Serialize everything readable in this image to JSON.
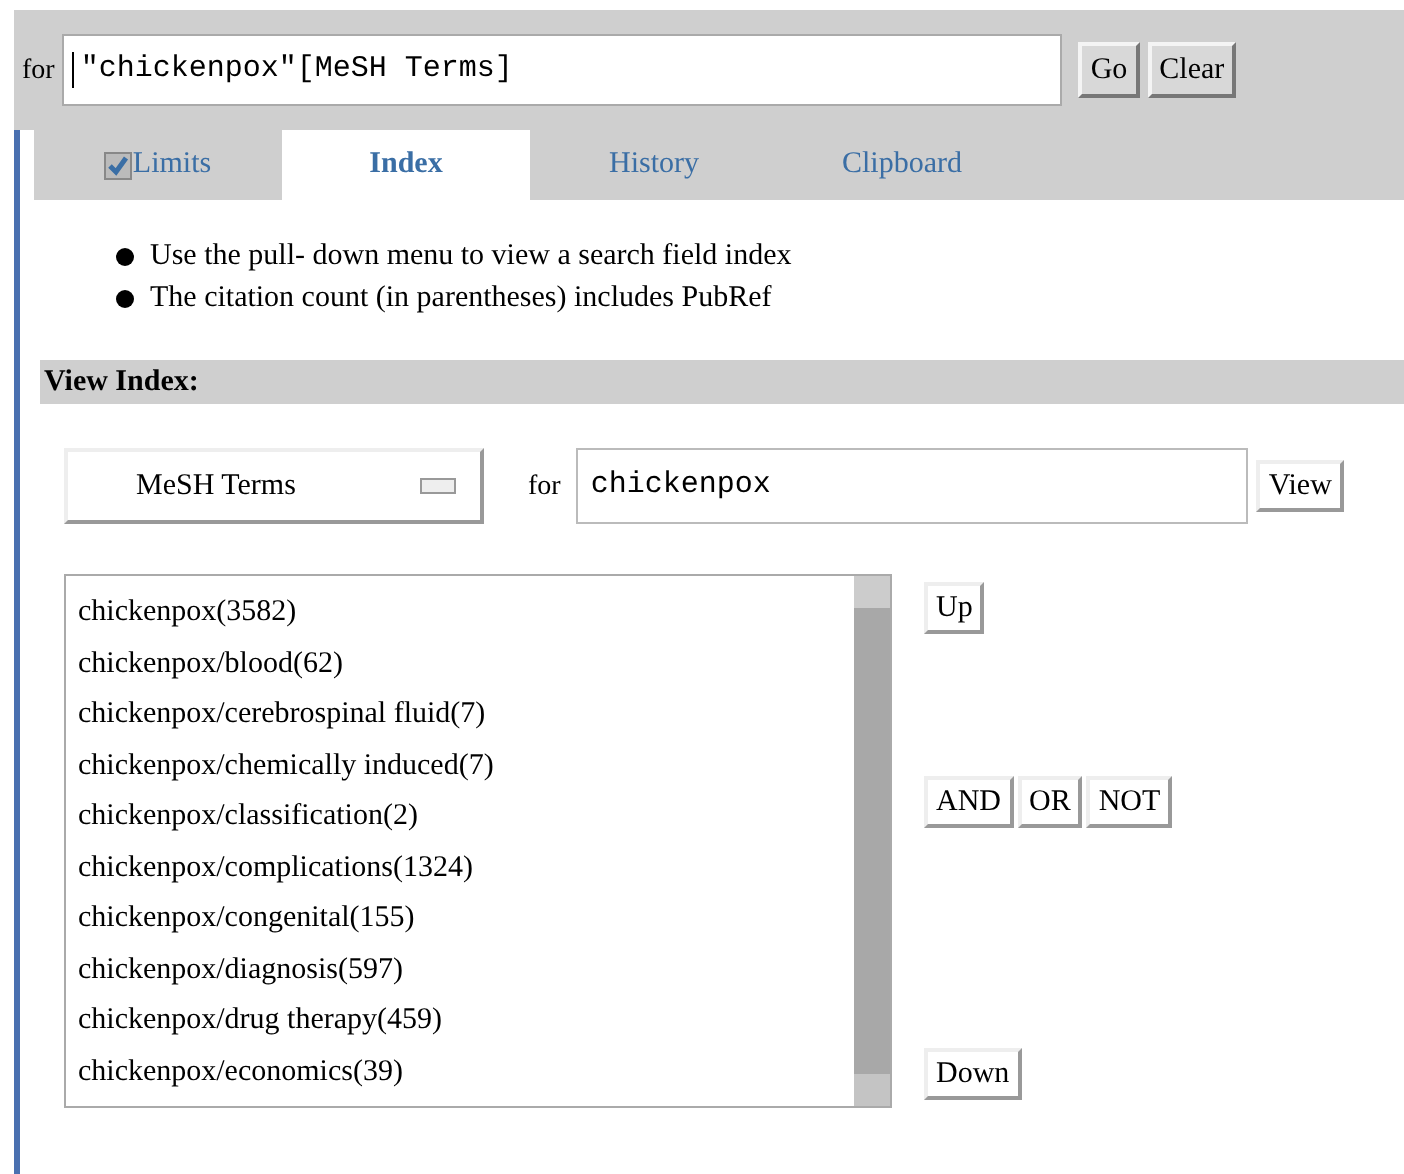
{
  "search": {
    "label": "for",
    "value": "\"chickenpox\"[MeSH Terms]",
    "buttons": [
      "Go",
      "Clear"
    ]
  },
  "tabs": [
    {
      "label": "Limits",
      "selected": false,
      "checked": true
    },
    {
      "label": "Index",
      "selected": true
    },
    {
      "label": "History",
      "selected": false
    },
    {
      "label": "Clipboard",
      "selected": false
    }
  ],
  "notes": [
    "Use the pull- down menu to view a search field index",
    "The citation count (in parentheses) includes PubRef"
  ],
  "view_index": {
    "heading": "View Index:",
    "field": "MeSH Terms",
    "for_label": "for",
    "value": "chickenpox",
    "view_button": "View",
    "items": [
      "chickenpox(3582)",
      "chickenpox/blood(62)",
      "chickenpox/cerebrospinal fluid(7)",
      "chickenpox/chemically induced(7)",
      "chickenpox/classification(2)",
      "chickenpox/complications(1324)",
      "chickenpox/congenital(155)",
      "chickenpox/diagnosis(597)",
      "chickenpox/drug therapy(459)",
      "chickenpox/economics(39)"
    ],
    "up_button": "Up",
    "operators": [
      "AND",
      "OR",
      "NOT"
    ],
    "down_button": "Down"
  }
}
